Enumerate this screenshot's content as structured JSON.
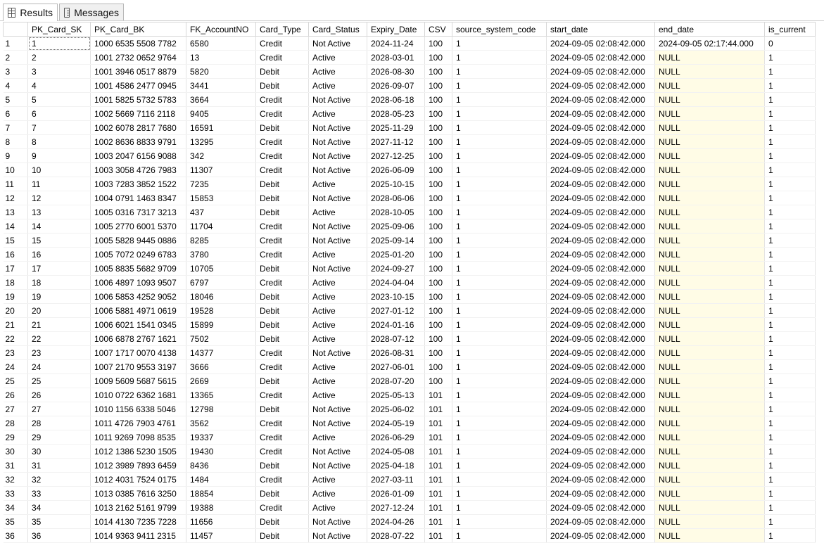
{
  "tabs": [
    {
      "label": "Results",
      "icon": "grid-icon",
      "active": true
    },
    {
      "label": "Messages",
      "icon": "message-icon",
      "active": false
    }
  ],
  "columns": [
    "",
    "PK_Card_SK",
    "PK_Card_BK",
    "FK_AccountNO",
    "Card_Type",
    "Card_Status",
    "Expiry_Date",
    "CSV",
    "source_system_code",
    "start_date",
    "end_date",
    "is_current"
  ],
  "rows": [
    [
      "1",
      "1",
      "1000 6535 5508 7782",
      "6580",
      "Credit",
      "Not Active",
      "2024-11-24",
      "100",
      "1",
      "2024-09-05 02:08:42.000",
      "2024-09-05 02:17:44.000",
      "0"
    ],
    [
      "2",
      "2",
      "1001 2732 0652 9764",
      "13",
      "Credit",
      "Active",
      "2028-03-01",
      "100",
      "1",
      "2024-09-05 02:08:42.000",
      "NULL",
      "1"
    ],
    [
      "3",
      "3",
      "1001 3946 0517 8879",
      "5820",
      "Debit",
      "Active",
      "2026-08-30",
      "100",
      "1",
      "2024-09-05 02:08:42.000",
      "NULL",
      "1"
    ],
    [
      "4",
      "4",
      "1001 4586 2477 0945",
      "3441",
      "Debit",
      "Active",
      "2026-09-07",
      "100",
      "1",
      "2024-09-05 02:08:42.000",
      "NULL",
      "1"
    ],
    [
      "5",
      "5",
      "1001 5825 5732 5783",
      "3664",
      "Credit",
      "Not Active",
      "2028-06-18",
      "100",
      "1",
      "2024-09-05 02:08:42.000",
      "NULL",
      "1"
    ],
    [
      "6",
      "6",
      "1002 5669 7116 2118",
      "9405",
      "Credit",
      "Active",
      "2028-05-23",
      "100",
      "1",
      "2024-09-05 02:08:42.000",
      "NULL",
      "1"
    ],
    [
      "7",
      "7",
      "1002 6078 2817 7680",
      "16591",
      "Debit",
      "Not Active",
      "2025-11-29",
      "100",
      "1",
      "2024-09-05 02:08:42.000",
      "NULL",
      "1"
    ],
    [
      "8",
      "8",
      "1002 8636 8833 9791",
      "13295",
      "Credit",
      "Not Active",
      "2027-11-12",
      "100",
      "1",
      "2024-09-05 02:08:42.000",
      "NULL",
      "1"
    ],
    [
      "9",
      "9",
      "1003 2047 6156 9088",
      "342",
      "Credit",
      "Not Active",
      "2027-12-25",
      "100",
      "1",
      "2024-09-05 02:08:42.000",
      "NULL",
      "1"
    ],
    [
      "10",
      "10",
      "1003 3058 4726 7983",
      "11307",
      "Credit",
      "Not Active",
      "2026-06-09",
      "100",
      "1",
      "2024-09-05 02:08:42.000",
      "NULL",
      "1"
    ],
    [
      "11",
      "11",
      "1003 7283 3852 1522",
      "7235",
      "Debit",
      "Active",
      "2025-10-15",
      "100",
      "1",
      "2024-09-05 02:08:42.000",
      "NULL",
      "1"
    ],
    [
      "12",
      "12",
      "1004 0791 1463 8347",
      "15853",
      "Debit",
      "Not Active",
      "2028-06-06",
      "100",
      "1",
      "2024-09-05 02:08:42.000",
      "NULL",
      "1"
    ],
    [
      "13",
      "13",
      "1005 0316 7317 3213",
      "437",
      "Debit",
      "Active",
      "2028-10-05",
      "100",
      "1",
      "2024-09-05 02:08:42.000",
      "NULL",
      "1"
    ],
    [
      "14",
      "14",
      "1005 2770 6001 5370",
      "11704",
      "Credit",
      "Not Active",
      "2025-09-06",
      "100",
      "1",
      "2024-09-05 02:08:42.000",
      "NULL",
      "1"
    ],
    [
      "15",
      "15",
      "1005 5828 9445 0886",
      "8285",
      "Credit",
      "Not Active",
      "2025-09-14",
      "100",
      "1",
      "2024-09-05 02:08:42.000",
      "NULL",
      "1"
    ],
    [
      "16",
      "16",
      "1005 7072 0249 6783",
      "3780",
      "Credit",
      "Active",
      "2025-01-20",
      "100",
      "1",
      "2024-09-05 02:08:42.000",
      "NULL",
      "1"
    ],
    [
      "17",
      "17",
      "1005 8835 5682 9709",
      "10705",
      "Debit",
      "Not Active",
      "2024-09-27",
      "100",
      "1",
      "2024-09-05 02:08:42.000",
      "NULL",
      "1"
    ],
    [
      "18",
      "18",
      "1006 4897 1093 9507",
      "6797",
      "Credit",
      "Active",
      "2024-04-04",
      "100",
      "1",
      "2024-09-05 02:08:42.000",
      "NULL",
      "1"
    ],
    [
      "19",
      "19",
      "1006 5853 4252 9052",
      "18046",
      "Debit",
      "Active",
      "2023-10-15",
      "100",
      "1",
      "2024-09-05 02:08:42.000",
      "NULL",
      "1"
    ],
    [
      "20",
      "20",
      "1006 5881 4971 0619",
      "19528",
      "Debit",
      "Active",
      "2027-01-12",
      "100",
      "1",
      "2024-09-05 02:08:42.000",
      "NULL",
      "1"
    ],
    [
      "21",
      "21",
      "1006 6021 1541 0345",
      "15899",
      "Debit",
      "Active",
      "2024-01-16",
      "100",
      "1",
      "2024-09-05 02:08:42.000",
      "NULL",
      "1"
    ],
    [
      "22",
      "22",
      "1006 6878 2767 1621",
      "7502",
      "Debit",
      "Active",
      "2028-07-12",
      "100",
      "1",
      "2024-09-05 02:08:42.000",
      "NULL",
      "1"
    ],
    [
      "23",
      "23",
      "1007 1717 0070 4138",
      "14377",
      "Credit",
      "Not Active",
      "2026-08-31",
      "100",
      "1",
      "2024-09-05 02:08:42.000",
      "NULL",
      "1"
    ],
    [
      "24",
      "24",
      "1007 2170 9553 3197",
      "3666",
      "Credit",
      "Active",
      "2027-06-01",
      "100",
      "1",
      "2024-09-05 02:08:42.000",
      "NULL",
      "1"
    ],
    [
      "25",
      "25",
      "1009 5609 5687 5615",
      "2669",
      "Debit",
      "Active",
      "2028-07-20",
      "100",
      "1",
      "2024-09-05 02:08:42.000",
      "NULL",
      "1"
    ],
    [
      "26",
      "26",
      "1010 0722 6362 1681",
      "13365",
      "Credit",
      "Active",
      "2025-05-13",
      "101",
      "1",
      "2024-09-05 02:08:42.000",
      "NULL",
      "1"
    ],
    [
      "27",
      "27",
      "1010 1156 6338 5046",
      "12798",
      "Debit",
      "Not Active",
      "2025-06-02",
      "101",
      "1",
      "2024-09-05 02:08:42.000",
      "NULL",
      "1"
    ],
    [
      "28",
      "28",
      "1011 4726 7903 4761",
      "3562",
      "Credit",
      "Not Active",
      "2024-05-19",
      "101",
      "1",
      "2024-09-05 02:08:42.000",
      "NULL",
      "1"
    ],
    [
      "29",
      "29",
      "1011 9269 7098 8535",
      "19337",
      "Credit",
      "Active",
      "2026-06-29",
      "101",
      "1",
      "2024-09-05 02:08:42.000",
      "NULL",
      "1"
    ],
    [
      "30",
      "30",
      "1012 1386 5230 1505",
      "19430",
      "Credit",
      "Not Active",
      "2024-05-08",
      "101",
      "1",
      "2024-09-05 02:08:42.000",
      "NULL",
      "1"
    ],
    [
      "31",
      "31",
      "1012 3989 7893 6459",
      "8436",
      "Debit",
      "Not Active",
      "2025-04-18",
      "101",
      "1",
      "2024-09-05 02:08:42.000",
      "NULL",
      "1"
    ],
    [
      "32",
      "32",
      "1012 4031 7524 0175",
      "1484",
      "Credit",
      "Active",
      "2027-03-11",
      "101",
      "1",
      "2024-09-05 02:08:42.000",
      "NULL",
      "1"
    ],
    [
      "33",
      "33",
      "1013 0385 7616 3250",
      "18854",
      "Debit",
      "Active",
      "2026-01-09",
      "101",
      "1",
      "2024-09-05 02:08:42.000",
      "NULL",
      "1"
    ],
    [
      "34",
      "34",
      "1013 2162 5161 9799",
      "19388",
      "Credit",
      "Active",
      "2027-12-24",
      "101",
      "1",
      "2024-09-05 02:08:42.000",
      "NULL",
      "1"
    ],
    [
      "35",
      "35",
      "1014 4130 7235 7228",
      "11656",
      "Debit",
      "Not Active",
      "2024-04-26",
      "101",
      "1",
      "2024-09-05 02:08:42.000",
      "NULL",
      "1"
    ],
    [
      "36",
      "36",
      "1014 9363 9411 2315",
      "11457",
      "Debit",
      "Not Active",
      "2028-07-22",
      "101",
      "1",
      "2024-09-05 02:08:42.000",
      "NULL",
      "1"
    ]
  ]
}
